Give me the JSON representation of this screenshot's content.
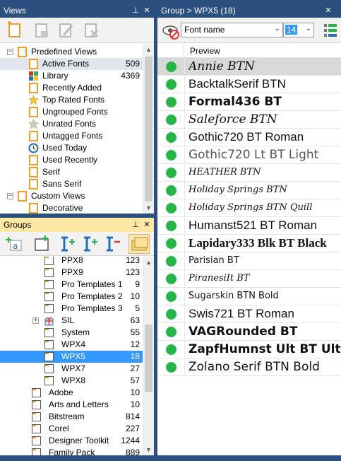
{
  "views_panel": {
    "title": "Views",
    "tree": [
      {
        "label": "Predefined Views",
        "count": "",
        "level": 0,
        "expander": "−",
        "icon": "predefined-views-icon"
      },
      {
        "label": "Active Fonts",
        "count": "509",
        "level": 1,
        "icon": "active-fonts-icon",
        "hilite": true
      },
      {
        "label": "Library",
        "count": "4369",
        "level": 1,
        "icon": "library-icon"
      },
      {
        "label": "Recently Added",
        "count": "",
        "level": 1,
        "icon": "recently-added-icon"
      },
      {
        "label": "Top Rated Fonts",
        "count": "",
        "level": 1,
        "icon": "star-icon"
      },
      {
        "label": "Ungrouped Fonts",
        "count": "",
        "level": 1,
        "icon": "ungrouped-fonts-icon"
      },
      {
        "label": "Unrated Fonts",
        "count": "",
        "level": 1,
        "icon": "unrated-star-icon"
      },
      {
        "label": "Untagged Fonts",
        "count": "",
        "level": 1,
        "icon": "untagged-fonts-icon"
      },
      {
        "label": "Used Today",
        "count": "",
        "level": 1,
        "icon": "clock-icon"
      },
      {
        "label": "Used Recently",
        "count": "",
        "level": 1,
        "icon": "used-recently-icon"
      },
      {
        "label": "Serif",
        "count": "",
        "level": 1,
        "icon": "serif-icon"
      },
      {
        "label": "Sans Serif",
        "count": "",
        "level": 1,
        "icon": "sans-serif-icon"
      },
      {
        "label": "Custom Views",
        "count": "",
        "level": 0,
        "expander": "−",
        "icon": "custom-views-icon"
      },
      {
        "label": "Decorative",
        "count": "",
        "level": 1,
        "icon": "decorative-icon"
      }
    ]
  },
  "groups_panel": {
    "title": "Groups",
    "tree": [
      {
        "label": "PPX8",
        "count": "123",
        "level": 2
      },
      {
        "label": "PPX9",
        "count": "123",
        "level": 2
      },
      {
        "label": "Pro Templates 1",
        "count": "9",
        "level": 2
      },
      {
        "label": "Pro Templates 2",
        "count": "10",
        "level": 2
      },
      {
        "label": "Pro Templates 3",
        "count": "5",
        "level": 2
      },
      {
        "label": "SIL",
        "count": "63",
        "level": 2,
        "expander": "+",
        "gift": true
      },
      {
        "label": "System",
        "count": "55",
        "level": 2
      },
      {
        "label": "WPX4",
        "count": "12",
        "level": 2
      },
      {
        "label": "WPX5",
        "count": "18",
        "level": 2,
        "selected": true
      },
      {
        "label": "WPX7",
        "count": "27",
        "level": 2
      },
      {
        "label": "WPX8",
        "count": "57",
        "level": 2
      },
      {
        "label": "Adobe",
        "count": "10",
        "level": 1
      },
      {
        "label": "Arts and Letters",
        "count": "10",
        "level": 1
      },
      {
        "label": "Bitstream",
        "count": "814",
        "level": 1
      },
      {
        "label": "Corel",
        "count": "227",
        "level": 1
      },
      {
        "label": "Designer Toolkit",
        "count": "1244",
        "level": 1
      },
      {
        "label": "Family Pack",
        "count": "889",
        "level": 1
      }
    ]
  },
  "fonts_panel": {
    "title": "Group > WPX5 (18)",
    "filter_select": "Font name",
    "size_value": "14",
    "preview_header": "Preview",
    "rows": [
      {
        "name": "Annie BTN",
        "family": "\"DejaVu Serif\", serif",
        "style": "italic",
        "weight": "normal",
        "selected": true
      },
      {
        "name": "BacktalkSerif BTN",
        "family": "\"Liberation Sans\", sans-serif",
        "style": "normal",
        "weight": "normal"
      },
      {
        "name": "Formal436 BT",
        "family": "\"DejaVu Sans\", sans-serif",
        "style": "normal",
        "weight": "bold"
      },
      {
        "name": "Saleforce BTN",
        "family": "\"DejaVu Serif\", serif",
        "style": "italic",
        "weight": "normal"
      },
      {
        "name": "Gothic720 BT Roman",
        "family": "\"Liberation Sans\", sans-serif",
        "style": "normal",
        "weight": "normal"
      },
      {
        "name": "Gothic720 Lt BT Light",
        "family": "\"DejaVu Sans\", sans-serif",
        "style": "normal",
        "weight": "normal",
        "light": true
      },
      {
        "name": "HEATHER BTN",
        "family": "\"DejaVu Serif\", serif",
        "style": "italic",
        "weight": "normal",
        "small": true
      },
      {
        "name": "Holiday Springs BTN",
        "family": "\"DejaVu Serif\", serif",
        "style": "italic",
        "weight": "normal",
        "small": true
      },
      {
        "name": "Holiday Springs BTN Quill",
        "family": "\"DejaVu Serif\", serif",
        "style": "italic",
        "weight": "normal",
        "small": true
      },
      {
        "name": "Humanst521 BT Roman",
        "family": "\"Liberation Sans\", sans-serif",
        "style": "normal",
        "weight": "normal"
      },
      {
        "name": "Lapidary333 Blk BT Black",
        "family": "\"Liberation Serif\", serif",
        "style": "normal",
        "weight": "bold"
      },
      {
        "name": "Parisian BT",
        "family": "\"DejaVu Sans\", sans-serif",
        "style": "normal",
        "weight": "normal",
        "small": true
      },
      {
        "name": "PiranesiIt BT",
        "family": "\"DejaVu Serif\", serif",
        "style": "italic",
        "weight": "normal",
        "small": true
      },
      {
        "name": "Sugarskin BTN Bold",
        "family": "\"DejaVu Sans\", sans-serif",
        "style": "normal",
        "weight": "normal",
        "small": true
      },
      {
        "name": "Swis721 BT Roman",
        "family": "\"Liberation Sans\", sans-serif",
        "style": "normal",
        "weight": "normal"
      },
      {
        "name": "VAGRounded BT",
        "family": "\"DejaVu Sans\", sans-serif",
        "style": "normal",
        "weight": "bold"
      },
      {
        "name": "ZapfHumnst Ult BT Ultra",
        "family": "\"DejaVu Sans\", sans-serif",
        "style": "normal",
        "weight": "bold"
      },
      {
        "name": "Zolano Serif BTN Bold",
        "family": "\"DejaVu Sans\", sans-serif",
        "style": "normal",
        "weight": "normal"
      }
    ]
  },
  "colors": {
    "title_bar": "#2b4f7e",
    "accent_selection": "#3399ff",
    "status_dot": "#27b54a",
    "groups_title": "#ffe8a6"
  }
}
